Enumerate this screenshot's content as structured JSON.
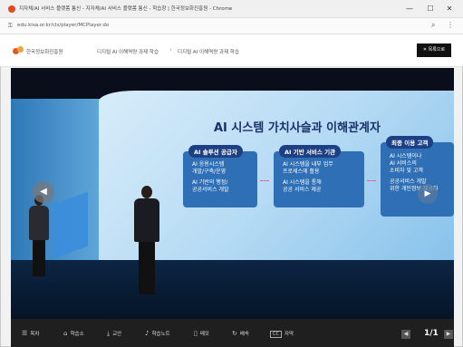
{
  "browser": {
    "title": "지자체/AI 서비스 플랫폼 통신 - 지자체/AI 서비스 플랫폼 통신 - 학습창 | 한국정보화진흥원 - Chrome",
    "url": "edu.kisa.or.kr/cls/player/MCPlayer.do",
    "zoom_icon": "search-icon",
    "menu_icon": "more-icon",
    "window_controls": [
      "—",
      "☐",
      "✕"
    ]
  },
  "header": {
    "logo_text": "한국정보화진흥원",
    "breadcrumb_1": "디지털 AI 이해역량 과제 학습",
    "breadcrumb_2": "디지털 AI 이해역량 과제 학습",
    "list_button": "✕ 목록으로"
  },
  "slide": {
    "title": "AI 시스템 가치사슬과 이해관계자",
    "cards": [
      {
        "head": "AI 솔루션 공급자",
        "items": [
          "AI 응용시스템",
          "개발/구축/운영",
          "AI 기반의 행정/",
          "공공서비스 개발"
        ]
      },
      {
        "head": "AI 기반 서비스 기관",
        "items": [
          "AI 시스템을 내부 업무",
          "프로세스에 활용",
          "AI 시스템을 통해",
          "공공 서비스 제공"
        ]
      },
      {
        "head": "최종 이용 고객",
        "items": [
          "AI 시스템이나",
          "AI 서비스의",
          "소비자 및 고객",
          "공공서비스 개발",
          "위한 개인정보 제공자"
        ]
      }
    ]
  },
  "controls": {
    "items": [
      {
        "icon": "menu-icon",
        "glyph": "☰",
        "label": "목차"
      },
      {
        "icon": "home-icon",
        "glyph": "⌂",
        "label": "학습소"
      },
      {
        "icon": "download-icon",
        "glyph": "⤓",
        "label": "교안"
      },
      {
        "icon": "mic-icon",
        "glyph": "♪",
        "label": "학습노트"
      },
      {
        "icon": "bookmark-icon",
        "glyph": "▯",
        "label": "메모"
      },
      {
        "icon": "speed-icon",
        "glyph": "↻",
        "label": "배속"
      },
      {
        "icon": "subtitle-icon",
        "glyph": "CC",
        "label": "자막"
      }
    ],
    "page_indicator": "1/1",
    "prev_icon": "prev-icon",
    "next_icon": "next-icon"
  }
}
